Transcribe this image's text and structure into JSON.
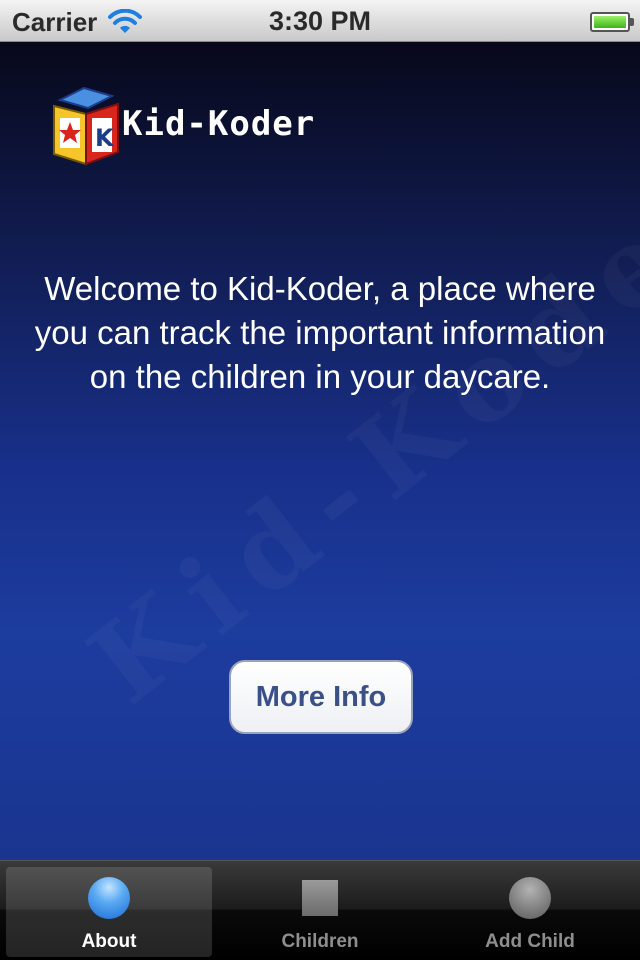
{
  "status_bar": {
    "carrier": "Carrier",
    "time": "3:30 PM",
    "wifi_icon": "wifi-icon",
    "battery_icon": "battery-icon",
    "battery_level": 1.0
  },
  "main": {
    "logo_text": "Kid-Koder",
    "logo_icon": "toy-block-icon",
    "welcome_text": "Welcome to Kid-Koder, a place where you can track the important information on the children in your daycare.",
    "watermark_text": "Kid-Koder",
    "more_info_label": "More Info"
  },
  "tab_bar": {
    "tabs": [
      {
        "label": "About",
        "icon": "circle-icon",
        "selected": true
      },
      {
        "label": "Children",
        "icon": "square-icon",
        "selected": false
      },
      {
        "label": "Add Child",
        "icon": "circle-icon",
        "selected": false
      }
    ]
  },
  "colors": {
    "background_top": "#07081a",
    "background_bottom": "#1c3c9e",
    "button_text": "#3b5089",
    "tab_selected_icon": "#5aaaf2"
  }
}
